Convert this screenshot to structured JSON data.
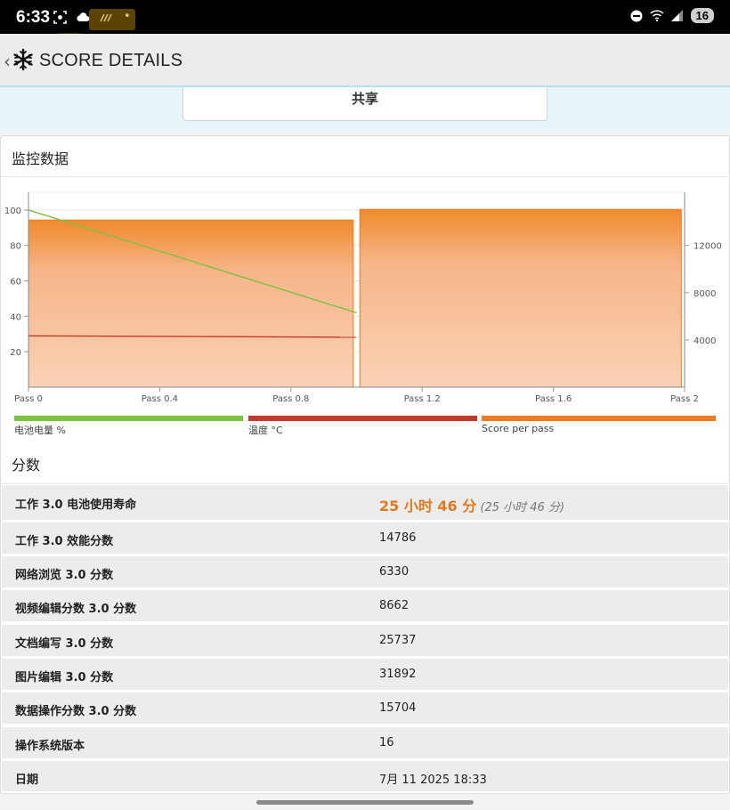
{
  "status_bar": {
    "time": "6:33",
    "battery": "16",
    "icons_left": [
      "screenshot-icon",
      "cloud-icon",
      "data-saver-icon",
      "dot-icon"
    ],
    "icons_right": [
      "do-not-disturb-icon",
      "wifi-icon",
      "signal-icon"
    ]
  },
  "header": {
    "title": "SCORE DETAILS",
    "back_glyph": "‹"
  },
  "share": {
    "label": "共享"
  },
  "monitoring": {
    "title": "监控数据"
  },
  "chart_data": {
    "type": "bar+line",
    "x_ticks": [
      "Pass 0",
      "Pass 0.4",
      "Pass 0.8",
      "Pass 1.2",
      "Pass 1.6",
      "Pass 2"
    ],
    "xlim": [
      0,
      2
    ],
    "left_axis": {
      "ylim": [
        0,
        110
      ],
      "ticks": [
        "20",
        "40",
        "60",
        "80",
        "100"
      ]
    },
    "right_axis": {
      "ylim": [
        0,
        16500
      ],
      "ticks": [
        "4000",
        "8000",
        "12000"
      ]
    },
    "series": [
      {
        "name": "电池电量 %",
        "kind": "line",
        "axis": "left",
        "color": "#7cc142",
        "points": [
          [
            0,
            100
          ],
          [
            1.0,
            42
          ]
        ]
      },
      {
        "name": "温度 °C",
        "kind": "line",
        "axis": "left",
        "color": "#c0392b",
        "points": [
          [
            0,
            29
          ],
          [
            1.0,
            28.2
          ]
        ]
      },
      {
        "name": "Score per pass",
        "kind": "bar",
        "axis": "right",
        "color": "#ee7a22",
        "bars": [
          {
            "x_start": 0,
            "x_end": 0.99,
            "value": 14150
          },
          {
            "x_start": 1.01,
            "x_end": 1.99,
            "value": 15050
          }
        ]
      }
    ],
    "legend_placement": "bottom"
  },
  "legend": {
    "battery": "电池电量 %",
    "temperature": "温度 °C",
    "score": "Score per pass",
    "colors": {
      "battery": "#7cc142",
      "temperature": "#c0392b",
      "score": "#ee7a22"
    }
  },
  "scores": {
    "title": "分数",
    "rows": [
      {
        "label": "工作 3.0 电池使用寿命",
        "value": "25 小时 46 分",
        "sub": "(25 小时 46 分)"
      },
      {
        "label": "工作 3.0 效能分数",
        "value": "14786"
      },
      {
        "label": "网络浏览 3.0 分数",
        "value": "6330"
      },
      {
        "label": "视频编辑分数 3.0 分数",
        "value": "8662"
      },
      {
        "label": "文档编写 3.0 分数",
        "value": "25737"
      },
      {
        "label": "图片编辑 3.0 分数",
        "value": "31892"
      },
      {
        "label": "数据操作分数 3.0 分数",
        "value": "15704"
      },
      {
        "label": "操作系统版本",
        "value": "16"
      },
      {
        "label": "日期",
        "value": "7月 11 2025 18:33"
      }
    ]
  }
}
